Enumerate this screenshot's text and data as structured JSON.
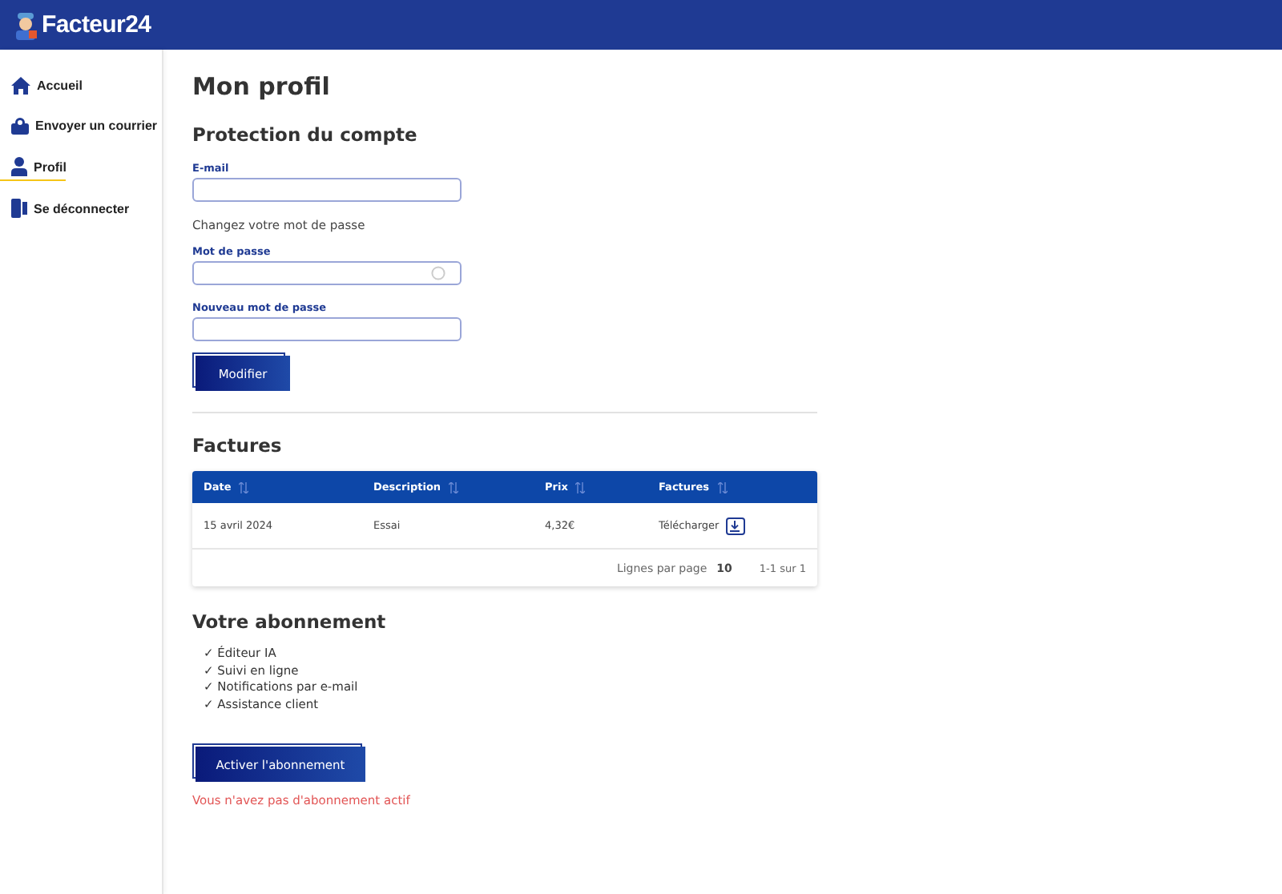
{
  "header": {
    "logo_text": "Facteur24"
  },
  "sidebar": {
    "items": [
      {
        "label": "Accueil",
        "kind": "home",
        "selected": false
      },
      {
        "label": "Envoyer un courrier",
        "kind": "mail",
        "selected": false
      },
      {
        "label": "Profil",
        "kind": "user",
        "selected": true
      },
      {
        "label": "Se déconnecter",
        "kind": "logout",
        "selected": false
      }
    ]
  },
  "page_title": "Mon profil",
  "security": {
    "title": "Protection du compte",
    "email": {
      "label": "E-mail"
    },
    "password_hint": "Changez votre mot de passe",
    "password": {
      "label": "Mot de passe"
    },
    "new_password": {
      "label": "Nouveau mot de passe"
    },
    "button": "Modifier"
  },
  "invoices": {
    "title": "Factures",
    "columns": [
      "Date",
      "Description",
      "Prix",
      "Factures"
    ],
    "rows": [
      {
        "date": "15 avril 2024",
        "description": "Essai",
        "price": "4,32€",
        "action": "Télécharger"
      }
    ],
    "rows_per_page_label": "Lignes par page",
    "rows_per_page": "10",
    "range": "1-1 sur 1"
  },
  "subscription": {
    "title": "Votre abonnement",
    "features": [
      "✓ Éditeur IA",
      "✓ Suivi en ligne",
      "✓ Notifications par e-mail",
      "✓ Assistance client"
    ],
    "button": "Activer l'abonnement",
    "status": "Vous n'avez pas d'abonnement actif"
  }
}
